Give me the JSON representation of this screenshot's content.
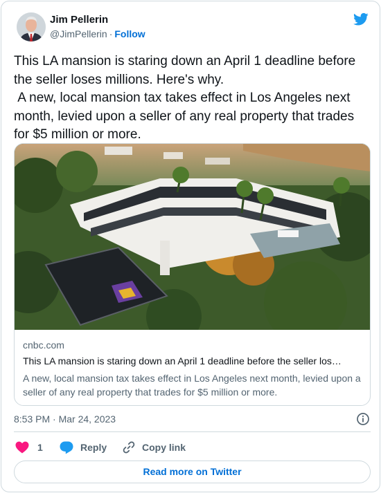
{
  "author": {
    "name": "Jim Pellerin",
    "handle": "@JimPellerin",
    "separator": "·",
    "follow_label": "Follow",
    "avatar_icon": "portrait-avatar"
  },
  "brand_icon": "twitter-bird-icon",
  "tweet": {
    "text": "This LA mansion is staring down an April 1 deadline before the seller loses millions. Here's why.\n A new, local mansion tax takes effect in Los Angeles next month, levied upon a seller of any real property that trades for $5 million or more."
  },
  "link_card": {
    "image": "aerial-mansion-photo",
    "domain": "cnbc.com",
    "title": "This LA mansion is staring down an April 1 deadline before the seller los…",
    "description": "A new, local mansion tax takes effect in Los Angeles next month, levied upon a seller of any real property that trades for $5 million or more."
  },
  "timestamp": "8:53 PM · Mar 24, 2023",
  "actions": {
    "like_count": "1",
    "reply_label": "Reply",
    "copy_link_label": "Copy link"
  },
  "read_more_label": "Read more on Twitter",
  "colors": {
    "brand": "#1d9bf0",
    "link": "#006fd6",
    "like": "#f91880",
    "muted": "#536471",
    "border": "#cfd9de"
  }
}
